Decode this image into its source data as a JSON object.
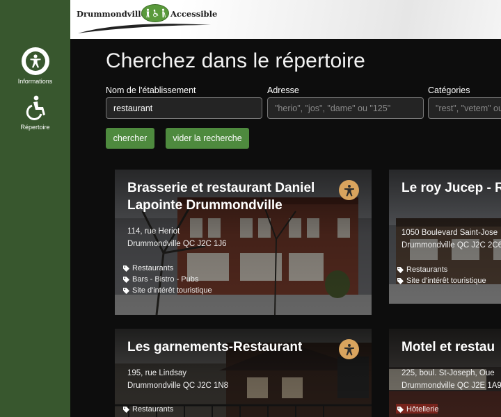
{
  "brand": {
    "left": "Drummondville",
    "right": "Accessible"
  },
  "sidebar": {
    "items": [
      {
        "label": "Informations",
        "icon": "accessibility-person-icon"
      },
      {
        "label": "Répertoire",
        "icon": "wheelchair-icon"
      }
    ]
  },
  "main": {
    "title": "Cherchez dans le répertoire"
  },
  "search": {
    "name_label": "Nom de l'établissement",
    "name_value": "restaurant",
    "address_label": "Adresse",
    "address_placeholder": "\"herio\", \"jos\", \"dame\" ou \"125\"",
    "categories_label": "Catégories",
    "categories_placeholder": "\"rest\", \"vetem\" ou",
    "search_button": "chercher",
    "clear_button": "vider la recherche"
  },
  "results": [
    {
      "name": "Brasserie et restaurant Daniel Lapointe Drummondville",
      "street": "114, rue Heriot",
      "city": "Drummondville QC J2C 1J6",
      "tags": [
        "Restaurants",
        "Bars - Bistro - Pubs",
        "Site d'intérêt touristique"
      ]
    },
    {
      "name": "Le roy Jucep - R québécois",
      "street": "1050 Boulevard Saint-Jose",
      "city": "Drummondville QC J2C 2C6",
      "tags": [
        "Restaurants",
        "Site d'intérêt touristique"
      ]
    },
    {
      "name": "Les garnements-Restaurant",
      "street": "195, rue Lindsay",
      "city": "Drummondville QC J2C 1N8",
      "tags": [
        "Restaurants"
      ]
    },
    {
      "name": "Motel et restau",
      "street": "225, boul. St-Joseph, Oue",
      "city": "Drummondville QC J2E 1A9",
      "tags": [
        "Hôtellerie"
      ]
    }
  ],
  "colors": {
    "sidebar": "#38572e",
    "button": "#4e8a3e",
    "accessibility_badge": "#d9a45e",
    "background": "#0d0d0d"
  }
}
